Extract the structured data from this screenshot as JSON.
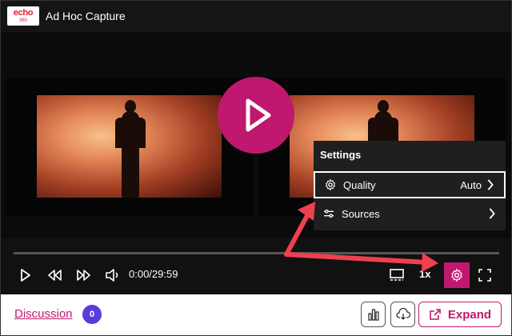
{
  "header": {
    "logo_top": "echo",
    "logo_bottom": "360",
    "title": "Ad Hoc Capture"
  },
  "player": {
    "time": "0:00/29:59",
    "rate": "1x"
  },
  "settings_menu": {
    "heading": "Settings",
    "items": [
      {
        "label": "Quality",
        "value": "Auto"
      },
      {
        "label": "Sources",
        "value": ""
      }
    ]
  },
  "footer": {
    "discussion_label": "Discussion",
    "discussion_count": "0",
    "expand_label": "Expand"
  },
  "colors": {
    "accent": "#c0186e",
    "badge": "#5b3bdd",
    "annotation": "#f04050"
  }
}
